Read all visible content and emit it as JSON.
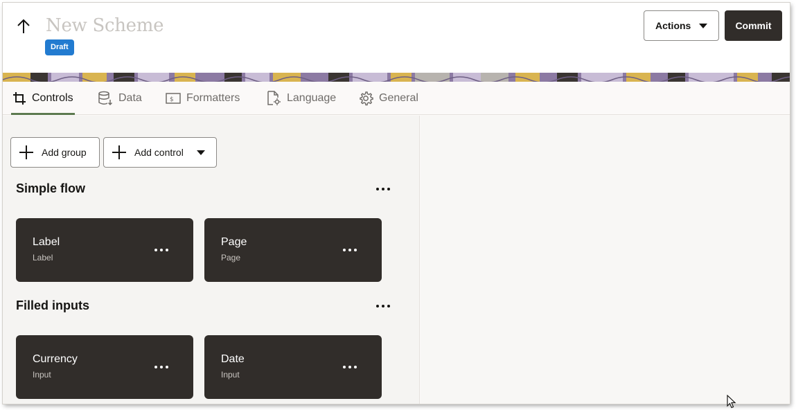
{
  "header": {
    "title": "New Scheme",
    "status_badge": "Draft",
    "actions_label": "Actions",
    "commit_label": "Commit"
  },
  "tabs": [
    {
      "label": "Controls",
      "icon": "crop-icon",
      "active": true
    },
    {
      "label": "Data",
      "icon": "database-icon",
      "active": false
    },
    {
      "label": "Formatters",
      "icon": "currency-formatter-icon",
      "active": false
    },
    {
      "label": "Language",
      "icon": "document-settings-icon",
      "active": false
    },
    {
      "label": "General",
      "icon": "gear-icon",
      "active": false
    }
  ],
  "toolbar": {
    "add_group_label": "Add group",
    "add_control_label": "Add control"
  },
  "groups": [
    {
      "title": "Simple flow",
      "cards": [
        {
          "title": "Label",
          "subtitle": "Label"
        },
        {
          "title": "Page",
          "subtitle": "Page"
        }
      ]
    },
    {
      "title": "Filled inputs",
      "cards": [
        {
          "title": "Currency",
          "subtitle": "Input"
        },
        {
          "title": "Date",
          "subtitle": "Input"
        }
      ]
    }
  ],
  "colors": {
    "badge": "#227bd0",
    "primary_button": "#312d2a",
    "card": "#312d2a",
    "active_tab_underline": "#5c7a4f"
  }
}
